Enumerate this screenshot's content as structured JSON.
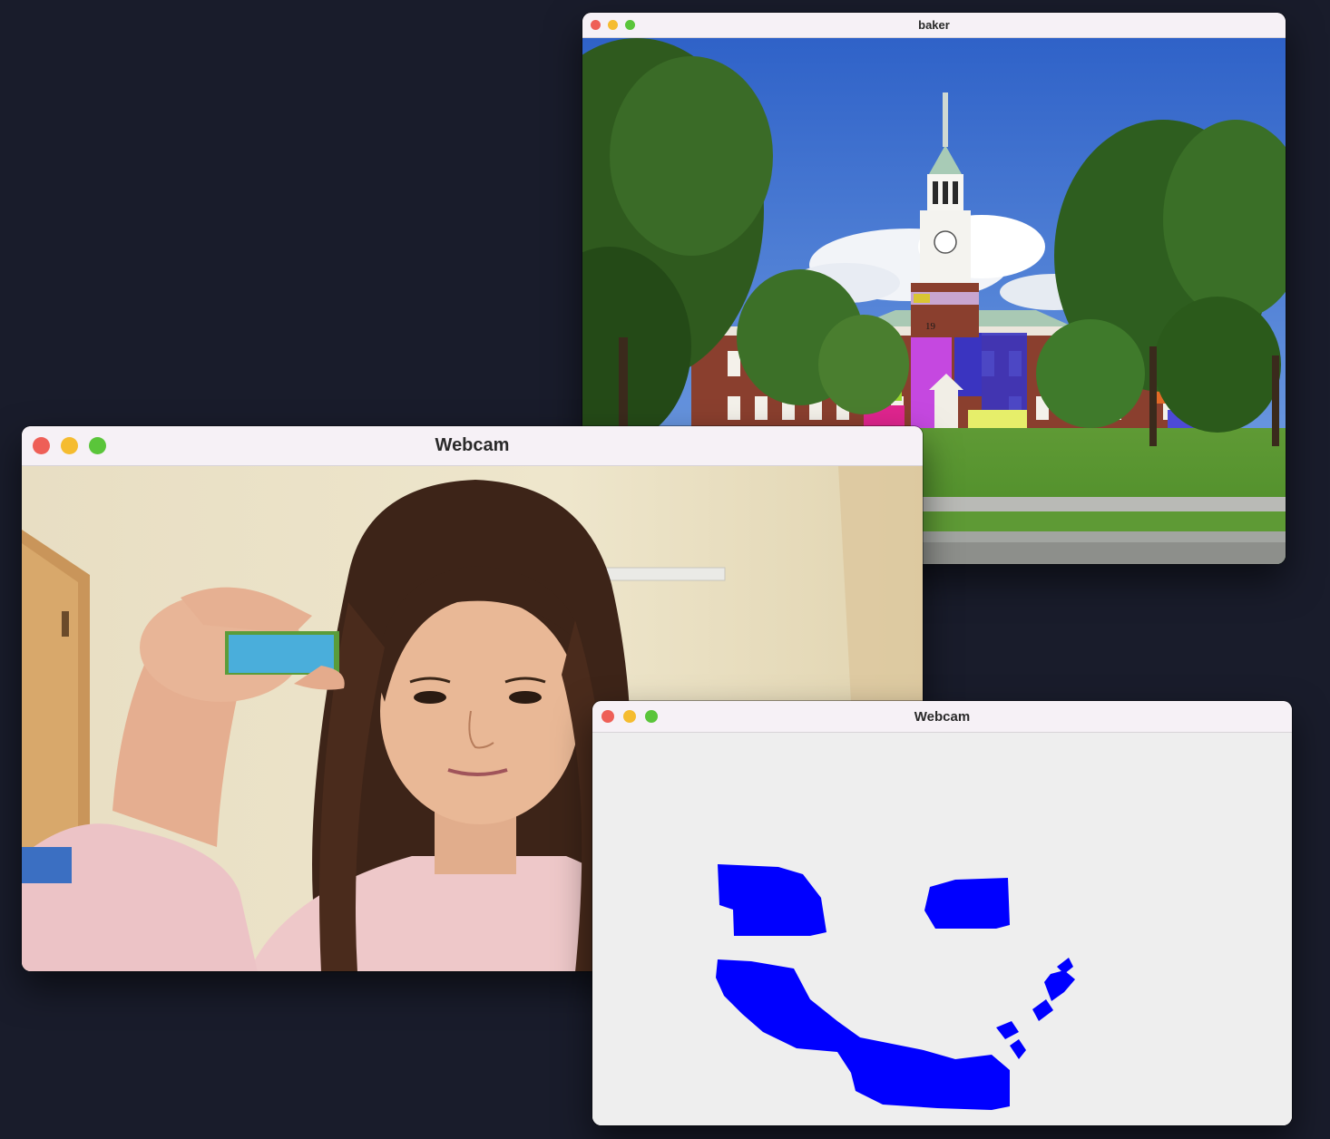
{
  "windows": {
    "baker": {
      "title": "baker"
    },
    "webcam_camera": {
      "title": "Webcam"
    },
    "webcam_mask": {
      "title": "Webcam"
    }
  },
  "image_text": {
    "clock_year": "19"
  },
  "colors": {
    "desktop_bg": "#191c2b",
    "titlebar_bg": "#f6f1f6",
    "close": "#ee5f57",
    "minimize": "#f5bc2f",
    "zoom": "#5ac53a",
    "mask_blue": "#0000ff",
    "mask_bg": "#eeeeee",
    "tracked_object": "#4aaedb"
  }
}
